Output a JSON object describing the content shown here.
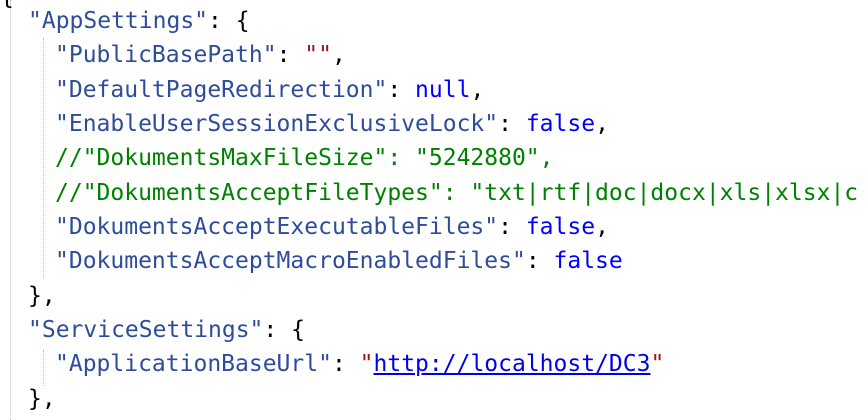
{
  "editor": {
    "top_brace": "{",
    "lines": [
      {
        "key": "\"AppSettings\"",
        "sep": ": ",
        "open": "{"
      },
      {
        "key": "\"PublicBasePath\"",
        "sep": ": ",
        "value": "\"\"",
        "end": ","
      },
      {
        "key": "\"DefaultPageRedirection\"",
        "sep": ": ",
        "value": "null",
        "end": ","
      },
      {
        "key": "\"EnableUserSessionExclusiveLock\"",
        "sep": ": ",
        "value": "false",
        "end": ","
      },
      {
        "comment": "//\"DokumentsMaxFileSize\": \"5242880\","
      },
      {
        "comment": "//\"DokumentsAcceptFileTypes\": \"txt|rtf|doc|docx|xls|xlsx|c"
      },
      {
        "key": "\"DokumentsAcceptExecutableFiles\"",
        "sep": ": ",
        "value": "false",
        "end": ","
      },
      {
        "key": "\"DokumentsAcceptMacroEnabledFiles\"",
        "sep": ": ",
        "value": "false"
      },
      {
        "close": "},"
      },
      {
        "key": "\"ServiceSettings\"",
        "sep": ": ",
        "open": "{"
      },
      {
        "key": "\"ApplicationBaseUrl\"",
        "sep": ": ",
        "quote_open": "\"",
        "link": "http://localhost/DC3",
        "quote_close": "\""
      },
      {
        "close": "},"
      }
    ]
  },
  "colors": {
    "key": "#2e4c9a",
    "string": "#a31515",
    "keyword": "#0000ff",
    "comment": "#008000",
    "link": "#0000ee"
  }
}
